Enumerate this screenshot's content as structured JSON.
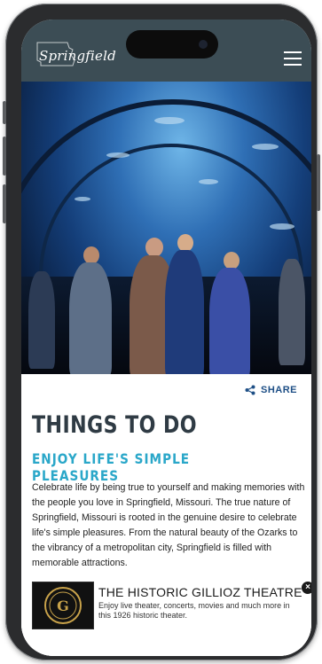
{
  "header": {
    "logo_text": "Springfield",
    "menu_icon": "hamburger-menu-icon"
  },
  "hero": {
    "image_subject": "aquarium tunnel with visitors"
  },
  "share": {
    "label": "SHARE",
    "icon": "share-icon"
  },
  "page": {
    "title": "THINGS TO DO",
    "subtitle": "ENJOY LIFE'S SIMPLE PLEASURES",
    "body": "Celebrate life by being true to yourself and making memories with the people you love in Springfield, Missouri. The true nature of Springfield, Missouri is rooted in the genuine desire to celebrate life's simple pleasures. From the natural beauty of the Ozarks to the vibrancy of a metropolitan city, Springfield is filled with memorable attractions."
  },
  "promo": {
    "title": "THE HISTORIC GILLIOZ THEATRE",
    "description": "Enjoy live theater, concerts, movies and much more in this 1926 historic theater.",
    "close_icon": "close-icon",
    "logo_letter": "G"
  },
  "colors": {
    "header_bg": "#3c4d55",
    "title": "#2f3b44",
    "subtitle": "#2aa7c9",
    "share": "#1e4f86"
  }
}
